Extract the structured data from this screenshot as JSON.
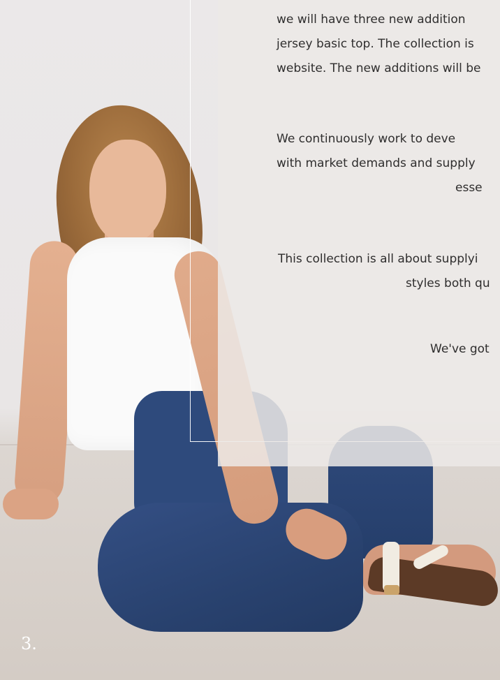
{
  "paragraphs": [
    {
      "lines": [
        "we will have three new addition",
        "jersey basic top. The collection is",
        "website. The new additions will be"
      ]
    },
    {
      "lines": [
        "We continuously work to deve",
        "with market demands and supply",
        "esse"
      ]
    },
    {
      "lines": [
        "This collection is all about supplyi",
        "styles both qu"
      ]
    },
    {
      "lines": [
        "We've got"
      ]
    }
  ],
  "page_number": "3.",
  "colors": {
    "panel": "#ECE9E7",
    "text": "#2F2E2E",
    "frame": "#FFFFFF"
  }
}
